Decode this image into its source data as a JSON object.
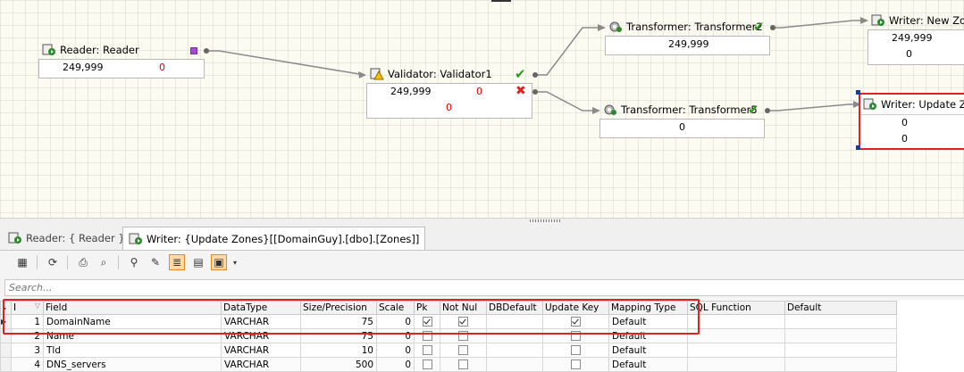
{
  "canvas": {
    "nodes": {
      "reader": {
        "title": "Reader: Reader",
        "count": "249,999",
        "err": "0"
      },
      "validator": {
        "title": "Validator: Validator1",
        "count": "249,999",
        "err": "0",
        "err2": "0"
      },
      "transformer2": {
        "title": "Transformer: Transformer2",
        "count": "249,999"
      },
      "transformer5": {
        "title": "Transformer: Transformer5",
        "count": "0"
      },
      "writer_new": {
        "title": "Writer: New Zone",
        "count": "249,999",
        "count2": "0"
      },
      "writer_update": {
        "title": "Writer: Update Zon",
        "count": "0",
        "count2": "0"
      }
    }
  },
  "tabs": [
    {
      "label": "Reader: { Reader }"
    },
    {
      "label": "Writer: {Update Zones}[[DomainGuy].[dbo].[Zones]]"
    }
  ],
  "search": {
    "placeholder": "Search..."
  },
  "grid": {
    "columns": [
      "I",
      "Field",
      "DataType",
      "Size/Precision",
      "Scale",
      "Pk",
      "Not Nul",
      "DBDefault",
      "Update Key",
      "Mapping Type",
      "SQL Function",
      "Default"
    ],
    "rows": [
      {
        "i": "1",
        "field": "DomainName",
        "type": "VARCHAR",
        "size": "75",
        "scale": "0",
        "pk": true,
        "notnull": true,
        "dbdefault": "",
        "updatekey": true,
        "mapping": "Default",
        "sqlfn": "",
        "def": ""
      },
      {
        "i": "2",
        "field": "Name",
        "type": "VARCHAR",
        "size": "75",
        "scale": "0",
        "pk": false,
        "notnull": false,
        "dbdefault": "",
        "updatekey": false,
        "mapping": "Default",
        "sqlfn": "",
        "def": ""
      },
      {
        "i": "3",
        "field": "Tld",
        "type": "VARCHAR",
        "size": "10",
        "scale": "0",
        "pk": false,
        "notnull": false,
        "dbdefault": "",
        "updatekey": false,
        "mapping": "Default",
        "sqlfn": "",
        "def": ""
      },
      {
        "i": "4",
        "field": "DNS_servers",
        "type": "VARCHAR",
        "size": "500",
        "scale": "0",
        "pk": false,
        "notnull": false,
        "dbdefault": "",
        "updatekey": false,
        "mapping": "Default",
        "sqlfn": "",
        "def": ""
      }
    ]
  },
  "colors": {
    "accent": "#e08a2c",
    "error": "#e00000",
    "ok": "#2c9a1e",
    "highlight": "#e02222"
  }
}
